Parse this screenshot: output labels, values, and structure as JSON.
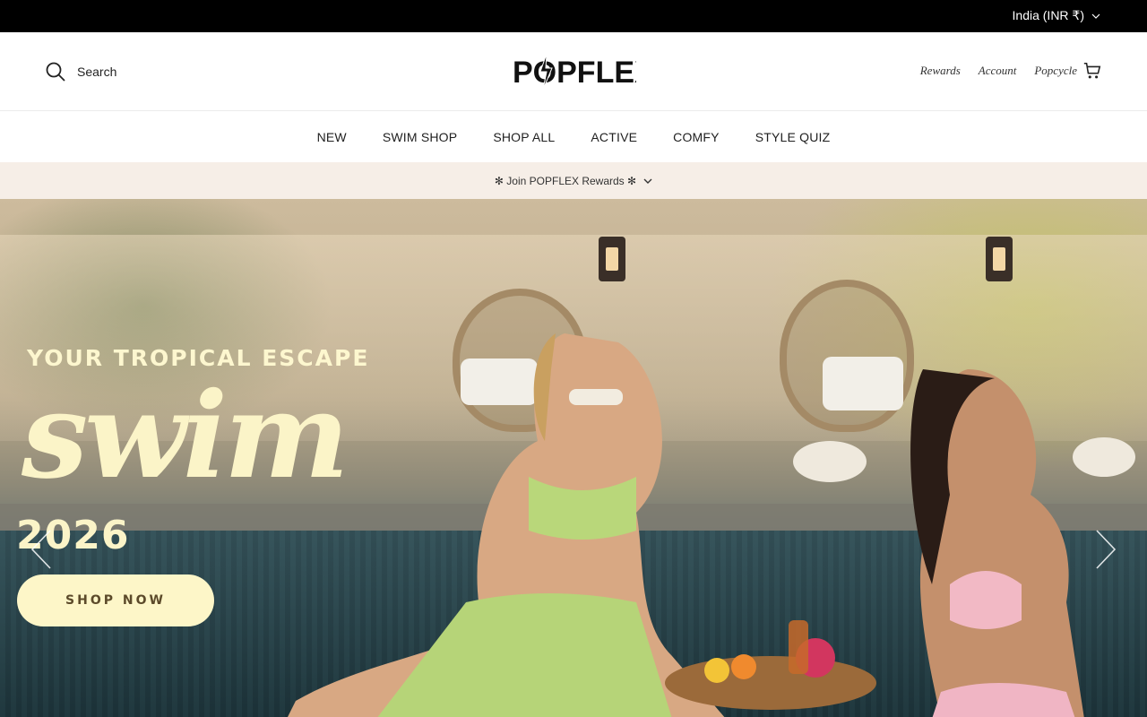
{
  "topbar": {
    "locale_label": "India (INR ₹)"
  },
  "header": {
    "search_label": "Search",
    "logo_text": "POPFLEX",
    "links": {
      "rewards": "Rewards",
      "account": "Account",
      "cart": "Popcycle"
    }
  },
  "nav": {
    "items": [
      {
        "label": "NEW"
      },
      {
        "label": "SWIM SHOP"
      },
      {
        "label": "SHOP ALL"
      },
      {
        "label": "ACTIVE"
      },
      {
        "label": "COMFY"
      },
      {
        "label": "STYLE QUIZ"
      }
    ]
  },
  "rewards_bar": {
    "label": "✻ Join POPFLEX Rewards ✻"
  },
  "hero": {
    "tagline": "YOUR TROPICAL ESCAPE",
    "headline": "swim",
    "year": "2026",
    "cta_label": "SHOP NOW"
  },
  "colors": {
    "topbar_bg": "#000000",
    "rewards_bar_bg": "#f6eee7",
    "hero_text": "#fbf4c8",
    "cta_bg": "#fdf6c8",
    "cta_text": "#5c4a2a"
  },
  "icons": {
    "search": "search-icon",
    "chevron": "chevron-down-icon",
    "cart": "cart-icon",
    "prev": "chevron-left-icon",
    "next": "chevron-right-icon"
  }
}
